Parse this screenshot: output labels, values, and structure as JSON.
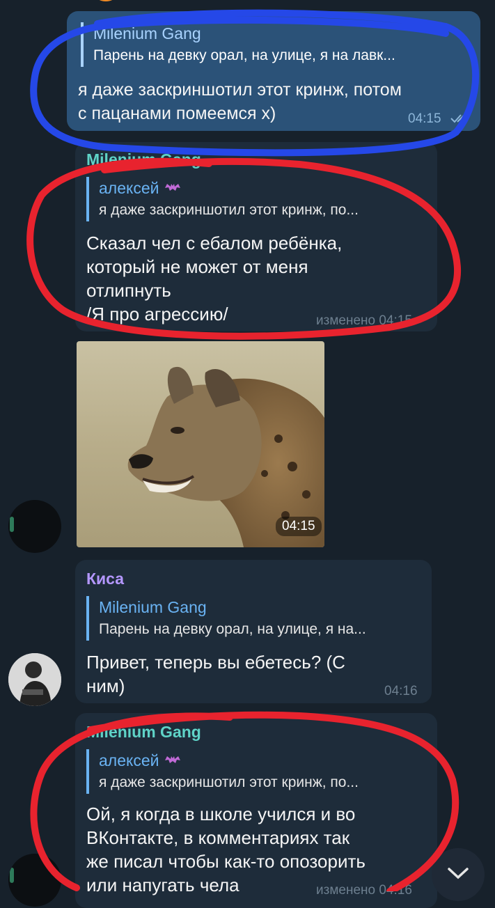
{
  "messages": [
    {
      "reply_name": "Milenium Gang",
      "reply_text": "Парень на девку орал, на улице, я на лавк...",
      "text_line1": "я даже заскриншотил этот кринж, потом",
      "text_line2": "с пацанами помеемся х)",
      "time": "04:15"
    },
    {
      "sender": "Milenium Gang",
      "reply_name": "алексей",
      "reply_text": "я даже заскриншотил этот кринж, по...",
      "lines": [
        "Сказал чел с ебалом ребёнка,",
        "который не может от меня",
        "отлипнуть",
        "/Я про агрессию/"
      ],
      "time": "изменено 04:15"
    },
    {
      "photo_time": "04:15"
    },
    {
      "sender": "Киса",
      "reply_name": "Milenium Gang",
      "reply_text": "Парень на девку орал, на улице, я на...",
      "lines": [
        "Привет, теперь вы ебетесь? (С",
        "ним)"
      ],
      "time": "04:16"
    },
    {
      "sender": "Milenium Gang",
      "reply_name": "алексей",
      "reply_text": "я даже заскриншотил этот кринж, по...",
      "lines": [
        "Ой, я когда в школе учился  и во",
        "ВКонтакте, в комментариях так",
        "же писал чтобы как-то опозорить",
        "или напугать чела"
      ],
      "time": "изменено 04:16"
    }
  ],
  "colors": {
    "background": "#17212b",
    "incoming_bubble": "#1e2c3a",
    "outgoing_bubble": "#2b5278",
    "accent": "#6ab3f3",
    "sender_teal": "#5fd3c7",
    "sender_purple": "#b497ff",
    "scribble_blue": "#2548e8",
    "scribble_red": "#e8232e"
  },
  "icons": [
    "double-check-icon",
    "bat-emoji-icon",
    "chevron-down-icon"
  ]
}
